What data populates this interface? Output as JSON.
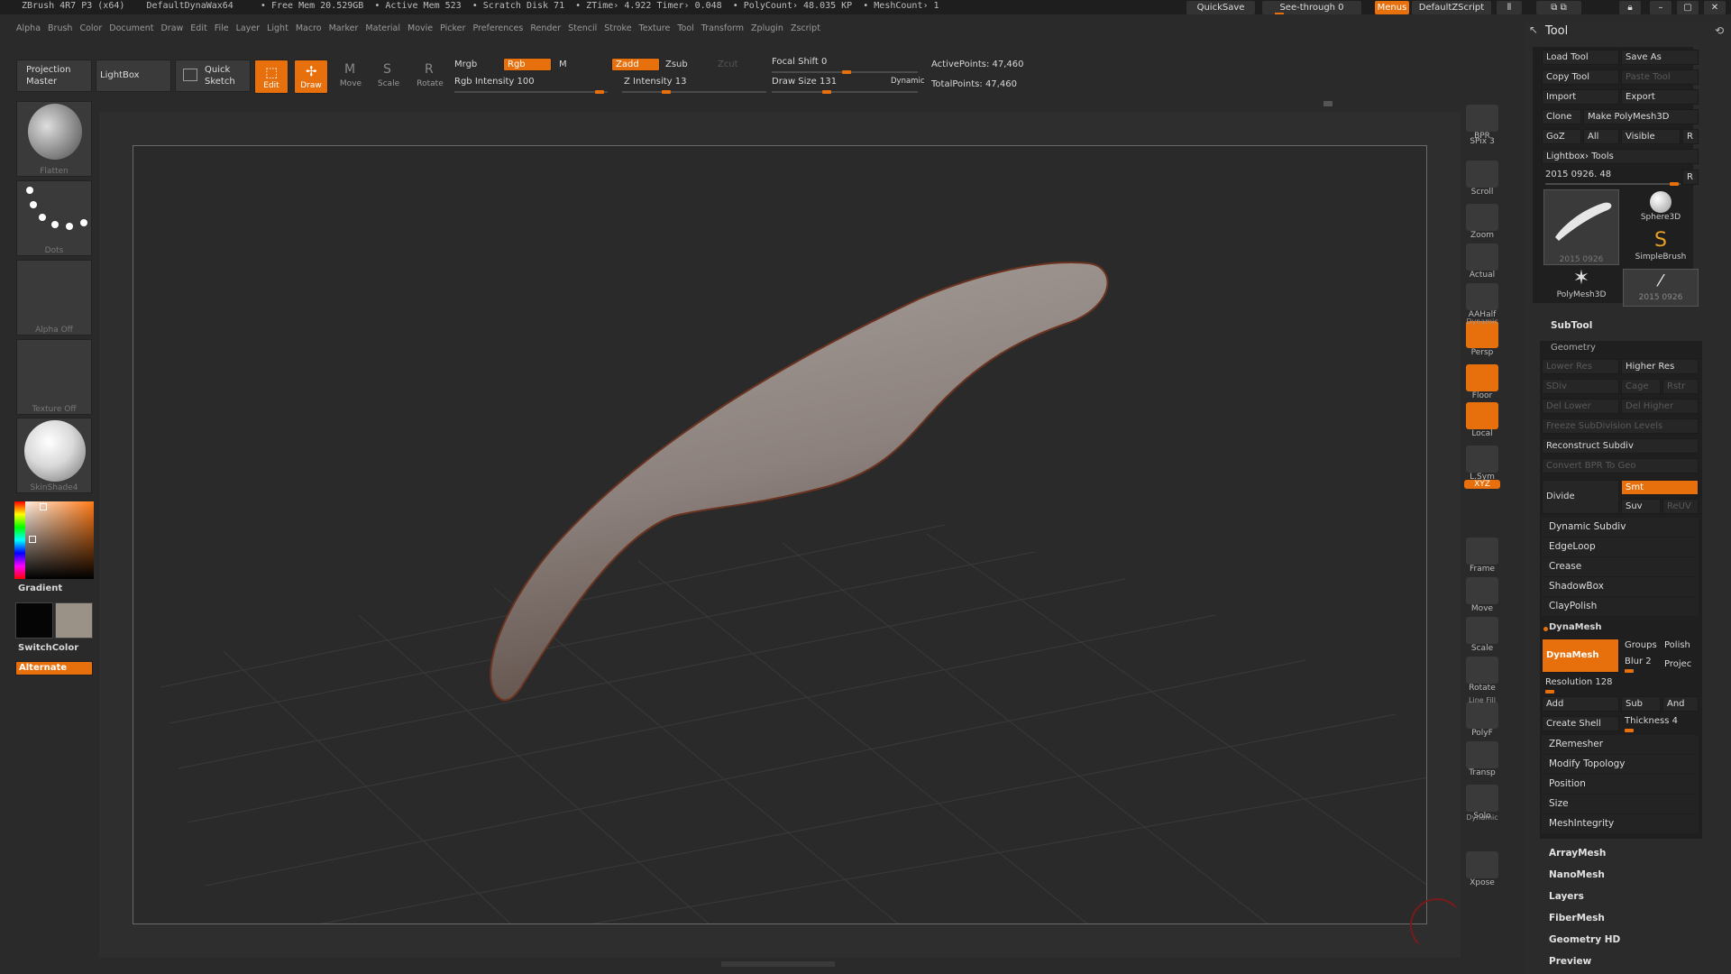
{
  "titlebar": {
    "app": "ZBrush 4R7 P3 (x64)",
    "doc": "DefaultDynaWax64",
    "free_mem": "• Free Mem 20.529GB",
    "active_mem": "• Active Mem 523",
    "scratch": "• Scratch Disk 71",
    "ztime": "• ZTime› 4.922  Timer› 0.048",
    "polycount": "• PolyCount› 48.035 KP",
    "meshcount": "• MeshCount› 1",
    "quicksave": "QuickSave",
    "seethrough": "See-through   0",
    "menus": "Menus",
    "script": "DefaultZScript"
  },
  "menus": [
    "Alpha",
    "Brush",
    "Color",
    "Document",
    "Draw",
    "Edit",
    "File",
    "Layer",
    "Light",
    "Macro",
    "Marker",
    "Material",
    "Movie",
    "Picker",
    "Preferences",
    "Render",
    "Stencil",
    "Stroke",
    "Texture",
    "Tool",
    "Transform",
    "Zplugin",
    "Zscript"
  ],
  "shelf": {
    "projection_master": "Projection Master",
    "lightbox": "LightBox",
    "quick_sketch": "Quick Sketch",
    "edit": "Edit",
    "draw": "Draw",
    "move": "Move",
    "scale": "Scale",
    "rotate": "Rotate",
    "mrgb": "Mrgb",
    "rgb": "Rgb",
    "m": "M",
    "rgb_intensity": "Rgb Intensity 100",
    "zadd": "Zadd",
    "zsub": "Zsub",
    "zcut": "Zcut",
    "z_intensity": "Z Intensity 13",
    "focal_shift": "Focal Shift 0",
    "draw_size": "Draw Size 131",
    "dynamic": "Dynamic",
    "active_points": "ActivePoints: 47,460",
    "total_points": "TotalPoints: 47,460"
  },
  "left": {
    "brush": "Flatten",
    "stroke": "Dots",
    "alpha": "Alpha Off",
    "texture": "Texture Off",
    "material": "SkinShade4",
    "gradient": "Gradient",
    "switchcolor": "SwitchColor",
    "alternate": "Alternate"
  },
  "right_tools": [
    {
      "label": "BPR"
    },
    {
      "label": "SPix 3"
    },
    {
      "label": "Scroll"
    },
    {
      "label": "Zoom"
    },
    {
      "label": "Actual"
    },
    {
      "label": "AAHalf"
    },
    {
      "label": "Persp"
    },
    {
      "label": "Floor"
    },
    {
      "label": "Local"
    },
    {
      "label": "L.Sym"
    },
    {
      "label": "XYZ"
    },
    {
      "label": "Frame"
    },
    {
      "label": "Move"
    },
    {
      "label": "Scale"
    },
    {
      "label": "Rotate"
    },
    {
      "label": "PolyF"
    },
    {
      "label": "Transp"
    },
    {
      "label": "Solo"
    },
    {
      "label": "Xpose"
    }
  ],
  "right_small": {
    "dynamic": "Dynamic",
    "line_fill": "Line Fill",
    "dynamic2": "Dynamic"
  },
  "tool": {
    "title": "Tool",
    "load_tool": "Load Tool",
    "save_as": "Save As",
    "copy_tool": "Copy Tool",
    "paste_tool": "Paste Tool",
    "import": "Import",
    "export": "Export",
    "clone": "Clone",
    "make_polymesh": "Make PolyMesh3D",
    "goz": "GoZ",
    "all": "All",
    "visible": "Visible",
    "r": "R",
    "lightbox_tools": "Lightbox› Tools",
    "current_tool": "2015 0926. 48",
    "thumbs": [
      "2015 0926",
      "Sphere3D",
      "SimpleBrush",
      "PolyMesh3D",
      "2015 0926"
    ],
    "subtool": "SubTool",
    "geometry": "Geometry",
    "lower_res": "Lower Res",
    "higher_res": "Higher Res",
    "sdiv": "SDiv",
    "cage": "Cage",
    "rstr": "Rstr",
    "del_lower": "Del Lower",
    "del_higher": "Del Higher",
    "freeze": "Freeze SubDivision Levels",
    "reconstruct": "Reconstruct Subdiv",
    "convert_bpr": "Convert BPR To Geo",
    "divide": "Divide",
    "smt": "Smt",
    "suv": "Suv",
    "reuv": "ReUV",
    "rows1": [
      "Dynamic Subdiv",
      "EdgeLoop",
      "Crease",
      "ShadowBox",
      "ClayPolish"
    ],
    "dynamesh_sec": "DynaMesh",
    "dynamesh_btn": "DynaMesh",
    "groups": "Groups",
    "polish": "Polish",
    "blur": "Blur 2",
    "project": "Projec",
    "resolution": "Resolution 128",
    "add": "Add",
    "sub": "Sub",
    "and": "And",
    "create_shell": "Create Shell",
    "thickness": "Thickness 4",
    "rows2": [
      "ZRemesher",
      "Modify Topology",
      "Position",
      "Size",
      "MeshIntegrity"
    ],
    "sections": [
      "ArrayMesh",
      "NanoMesh",
      "Layers",
      "FiberMesh",
      "Geometry HD",
      "Preview"
    ]
  },
  "colors": {
    "accent": "#e8700c",
    "bg": "#2a2a2a"
  }
}
